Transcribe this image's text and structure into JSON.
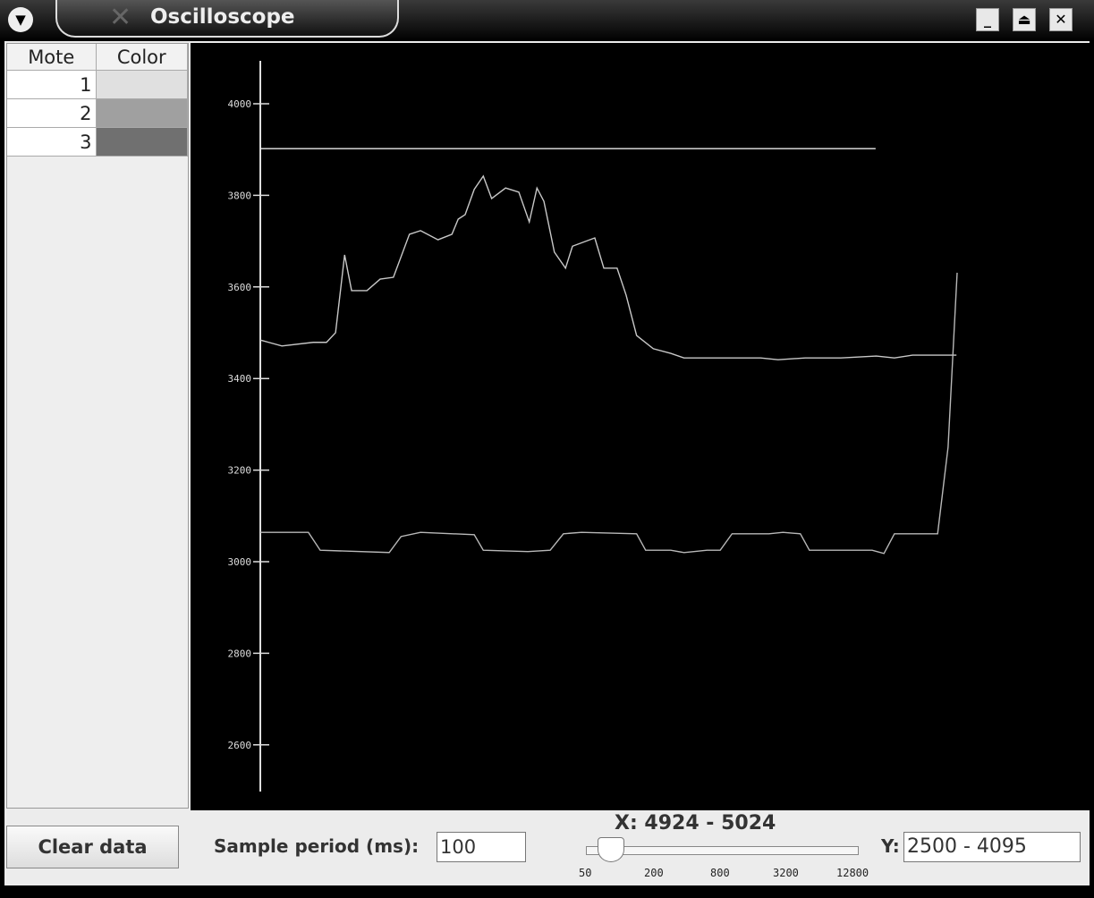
{
  "window": {
    "title": "Oscilloscope",
    "menu_icon": "chevron-down-icon",
    "controls": [
      "minimize",
      "maximize",
      "close"
    ]
  },
  "table": {
    "headers": [
      "Mote",
      "Color"
    ],
    "rows": [
      {
        "mote": "1",
        "color": "#e0e0e0"
      },
      {
        "mote": "2",
        "color": "#a0a0a0"
      },
      {
        "mote": "3",
        "color": "#707070"
      }
    ]
  },
  "controls": {
    "clear_label": "Clear data",
    "sample_label": "Sample period (ms):",
    "sample_value": "100",
    "x_label": "X: 4924 - 5024",
    "y_label": "Y:",
    "y_value": "2500 - 4095",
    "slider_ticks": [
      "50",
      "200",
      "800",
      "3200",
      "12800"
    ],
    "slider_value": 100
  },
  "chart_data": {
    "type": "line",
    "xlim": [
      4924,
      5024
    ],
    "ylim": [
      2500,
      4095
    ],
    "yticks": [
      "2600",
      "2800",
      "3000",
      "3200",
      "3400",
      "3600",
      "3800",
      "4000"
    ],
    "series": [
      {
        "name": "1",
        "color": "#e8e8e8",
        "points": [
          [
            0,
            3902
          ],
          [
            88.3,
            3902
          ]
        ]
      },
      {
        "name": "2",
        "color": "#c8c8c8",
        "points": [
          [
            0,
            3484
          ],
          [
            1.2,
            3479
          ],
          [
            3.1,
            3471
          ],
          [
            7.6,
            3479
          ],
          [
            9.5,
            3479
          ],
          [
            10.8,
            3500
          ],
          [
            12.1,
            3670
          ],
          [
            13.1,
            3592
          ],
          [
            15.3,
            3592
          ],
          [
            17.2,
            3617
          ],
          [
            19.1,
            3621
          ],
          [
            21.4,
            3715
          ],
          [
            23,
            3723
          ],
          [
            25.5,
            3703
          ],
          [
            27.5,
            3715
          ],
          [
            28.4,
            3748
          ],
          [
            29.4,
            3758
          ],
          [
            30.7,
            3813
          ],
          [
            32,
            3842
          ],
          [
            33.2,
            3793
          ],
          [
            35.2,
            3816
          ],
          [
            37.1,
            3807
          ],
          [
            38.6,
            3742
          ],
          [
            39.7,
            3816
          ],
          [
            40.7,
            3787
          ],
          [
            42.2,
            3676
          ],
          [
            43.8,
            3641
          ],
          [
            44.8,
            3689
          ],
          [
            48,
            3707
          ],
          [
            49.3,
            3641
          ],
          [
            51.2,
            3641
          ],
          [
            52.5,
            3582
          ],
          [
            54,
            3494
          ],
          [
            56.4,
            3465
          ],
          [
            58.9,
            3455
          ],
          [
            60.8,
            3445
          ],
          [
            64.1,
            3445
          ],
          [
            71.8,
            3445
          ],
          [
            74.3,
            3441
          ],
          [
            78.2,
            3445
          ],
          [
            83.3,
            3445
          ],
          [
            88.4,
            3449
          ],
          [
            91,
            3445
          ],
          [
            93.6,
            3451
          ],
          [
            99.9,
            3451
          ]
        ]
      },
      {
        "name": "3",
        "color": "#b8b8b8",
        "points": [
          [
            0,
            3064
          ],
          [
            6.9,
            3064
          ],
          [
            8.6,
            3025
          ],
          [
            18.5,
            3020
          ],
          [
            20.2,
            3055
          ],
          [
            23,
            3064
          ],
          [
            30.7,
            3059
          ],
          [
            32,
            3025
          ],
          [
            38.4,
            3022
          ],
          [
            41.6,
            3025
          ],
          [
            43.5,
            3061
          ],
          [
            46.1,
            3064
          ],
          [
            54,
            3061
          ],
          [
            55.3,
            3025
          ],
          [
            58.9,
            3025
          ],
          [
            60.8,
            3020
          ],
          [
            64.1,
            3025
          ],
          [
            66,
            3025
          ],
          [
            67.7,
            3061
          ],
          [
            73,
            3061
          ],
          [
            75,
            3064
          ],
          [
            77.5,
            3061
          ],
          [
            78.8,
            3025
          ],
          [
            87.8,
            3025
          ],
          [
            89.5,
            3018
          ],
          [
            91,
            3061
          ],
          [
            97.2,
            3061
          ],
          [
            98.7,
            3250
          ],
          [
            100,
            3631
          ]
        ]
      }
    ]
  }
}
